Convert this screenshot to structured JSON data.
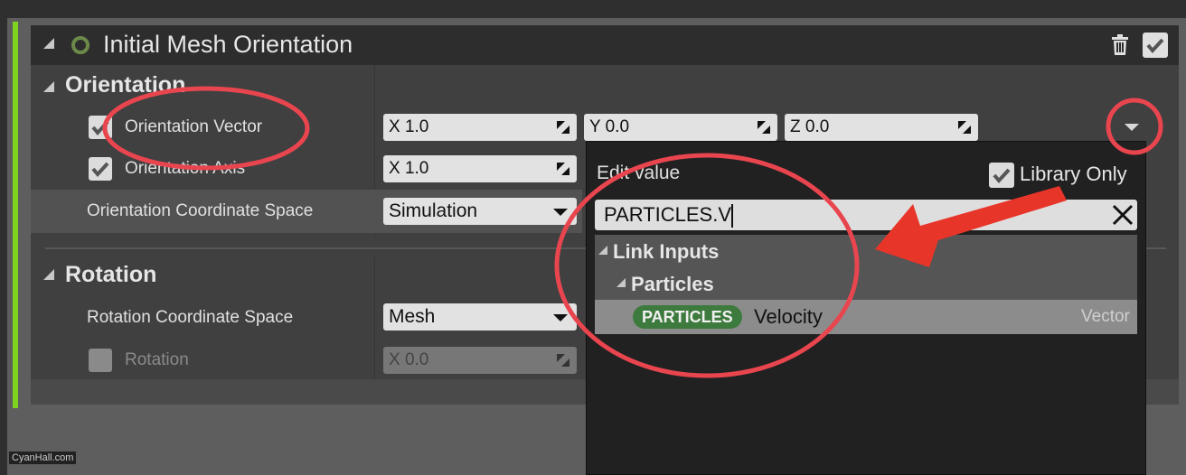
{
  "module": {
    "title": "Initial Mesh Orientation",
    "enabled": true,
    "accent_color": "#7ed321"
  },
  "sections": {
    "orientation": {
      "title": "Orientation",
      "rows": {
        "vector": {
          "label": "Orientation Vector",
          "checked": true,
          "x": "X 1.0",
          "y": "Y 0.0",
          "z": "Z 0.0"
        },
        "axis": {
          "label": "Orientation Axis",
          "checked": true,
          "x": "X 1.0"
        },
        "space": {
          "label": "Orientation Coordinate Space",
          "value": "Simulation"
        }
      }
    },
    "rotation": {
      "title": "Rotation",
      "rows": {
        "space": {
          "label": "Rotation Coordinate Space",
          "value": "Mesh"
        },
        "rotation": {
          "label": "Rotation",
          "checked": false,
          "x": "X 0.0"
        }
      }
    }
  },
  "popup": {
    "title": "Edit value",
    "library_only_label": "Library Only",
    "library_only_checked": true,
    "search_value": "PARTICLES.V",
    "tree": {
      "category": "Link Inputs",
      "subcategory": "Particles",
      "item": {
        "namespace": "PARTICLES",
        "name": "Velocity",
        "type": "Vector"
      }
    }
  },
  "watermark": "CyanHall.com",
  "annotation_color": "#e8454f"
}
